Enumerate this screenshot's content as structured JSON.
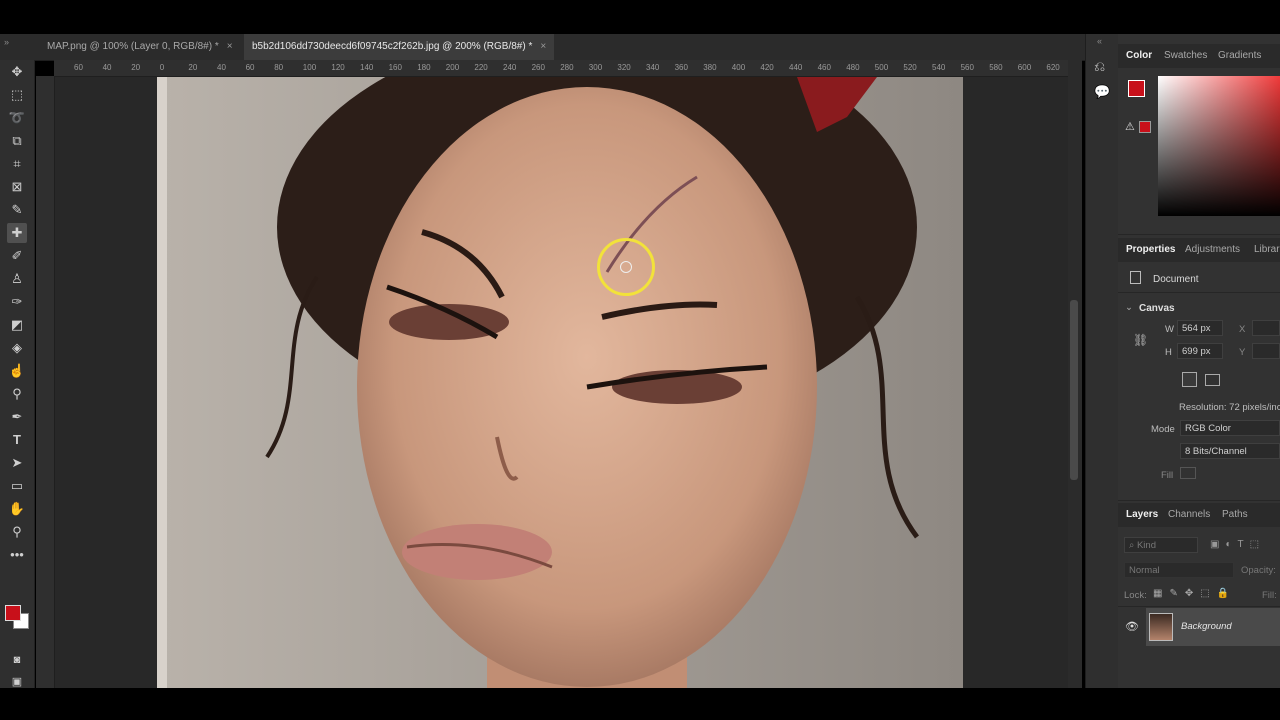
{
  "tabs": [
    {
      "label": "MAP.png @ 100% (Layer 0, RGB/8#) *",
      "close": "×"
    },
    {
      "label": "b5b2d106dd730deecd6f09745c2f262b.jpg @ 200% (RGB/8#) *",
      "close": "×"
    }
  ],
  "ruler": {
    "h_ticks": [
      "60",
      "40",
      "20",
      "0",
      "20",
      "40",
      "60",
      "80",
      "100",
      "120",
      "140",
      "160",
      "180",
      "200",
      "220",
      "240",
      "260",
      "280",
      "300",
      "320",
      "340",
      "360",
      "380",
      "400",
      "420",
      "440",
      "460",
      "480",
      "500",
      "520",
      "540",
      "560",
      "580",
      "600",
      "620"
    ]
  },
  "color_panel": {
    "tabs": [
      "Color",
      "Swatches",
      "Gradients"
    ],
    "foreground": "#c8101a",
    "background": "#ffffff"
  },
  "properties": {
    "tabs": [
      "Properties",
      "Adjustments",
      "Librar"
    ],
    "section": "Document",
    "canvas_title": "Canvas",
    "w_label": "W",
    "w_value": "564 px",
    "h_label": "H",
    "h_value": "699 px",
    "x_label": "X",
    "y_label": "Y",
    "resolution": "Resolution: 72 pixels/inc",
    "mode_label": "Mode",
    "mode_value": "RGB Color",
    "bits_value": "8 Bits/Channel",
    "fill_label": "Fill"
  },
  "layers": {
    "tabs": [
      "Layers",
      "Channels",
      "Paths"
    ],
    "kind_placeholder": "Kind",
    "blend_mode": "Normal",
    "opacity_label": "Opacity:",
    "lock_label": "Lock:",
    "fill_label": "Fill:",
    "items": [
      {
        "name": "Background"
      }
    ]
  },
  "icons": {
    "tools": [
      "move-icon",
      "marquee-icon",
      "lasso-icon",
      "object-select-icon",
      "crop-icon",
      "frame-icon",
      "eyedropper-icon",
      "spot-healing-icon",
      "brush-icon",
      "clone-stamp-icon",
      "history-brush-icon",
      "eraser-icon",
      "paint-bucket-icon",
      "smudge-icon",
      "dodge-icon",
      "pen-icon",
      "type-icon",
      "path-select-icon",
      "rectangle-icon",
      "hand-icon",
      "zoom-icon",
      "more-tools-icon"
    ]
  }
}
